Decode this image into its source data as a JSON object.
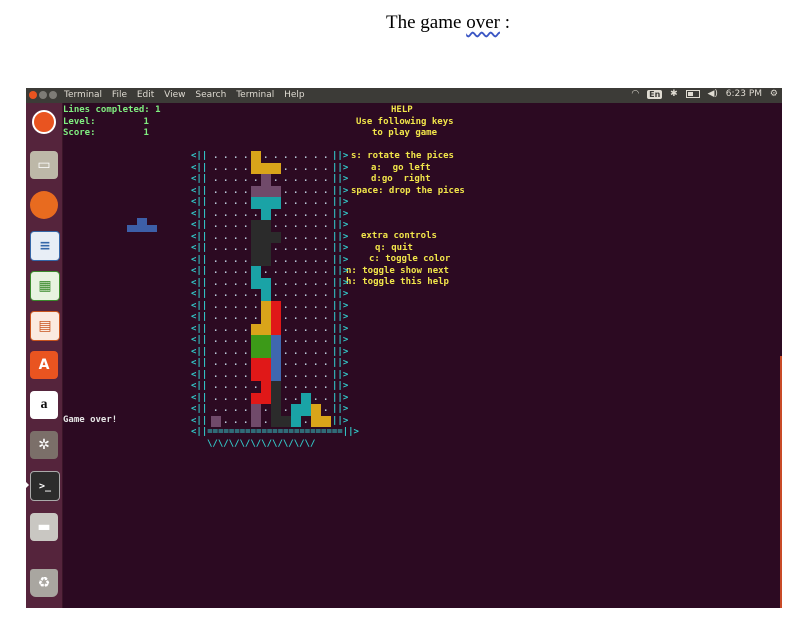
{
  "document": {
    "caption_pre": "The game ",
    "caption_word": "over",
    "caption_post": " :"
  },
  "topbar": {
    "menus": [
      "Terminal",
      "File",
      "Edit",
      "View",
      "Search",
      "Terminal",
      "Help"
    ],
    "keyboard": "En",
    "wifi_icon": "wifi-icon",
    "bluetooth_icon": "bluetooth-icon",
    "battery_level": 0.5,
    "volume_icon": "volume-icon",
    "time": "6:23 PM",
    "gear_icon": "gear-icon"
  },
  "launcher": {
    "items": [
      {
        "name": "ubuntu-logo-icon",
        "glyph": "◉"
      },
      {
        "name": "files-icon",
        "glyph": "▭"
      },
      {
        "name": "firefox-icon",
        "glyph": "●"
      },
      {
        "name": "writer-icon",
        "glyph": "≡"
      },
      {
        "name": "calc-icon",
        "glyph": "▦"
      },
      {
        "name": "impress-icon",
        "glyph": "▤"
      },
      {
        "name": "software-center-icon",
        "glyph": "A"
      },
      {
        "name": "amazon-icon",
        "glyph": "a"
      },
      {
        "name": "system-settings-icon",
        "glyph": "✲"
      },
      {
        "name": "terminal-icon",
        "glyph": ">_"
      },
      {
        "name": "drive-icon",
        "glyph": "▬"
      },
      {
        "name": "trash-icon",
        "glyph": "♻"
      }
    ]
  },
  "game": {
    "stats": {
      "lines_label": "Lines completed:",
      "lines_value": "1",
      "level_label": "Level:",
      "level_value": "1",
      "score_label": "Score:",
      "score_value": "1"
    },
    "status": "Game over!",
    "help": {
      "title": "HELP",
      "line1": "Use following keys",
      "line2": "to play game",
      "rotate": "s: rotate the pices",
      "left": "a:  go left",
      "right": "d:go  right",
      "drop": "space: drop the pices",
      "extra_title": "extra controls",
      "quit": "q: quit",
      "color": "c: toggle color",
      "next": "n: toggle show next",
      "helpkey": "h: toggle this help"
    },
    "wall_left": "<||",
    "wall_right": "||>",
    "floor": "<||=========================||>",
    "base": "\\/\\/\\/\\/\\/\\/\\/\\/\\/\\/",
    "colors": {
      "yellow": "#d9a41a",
      "purple": "#704a6a",
      "teal": "#1aa3a6",
      "dark": "#2b2b2b",
      "red": "#e01818",
      "green": "#3c9a18",
      "blue": "#3f67ae",
      "gray": "#3a3a3a"
    },
    "next_piece_color": "#3d5fa8",
    "board_cells": [
      [
        0,
        4,
        "yellow"
      ],
      [
        1,
        4,
        "yellow"
      ],
      [
        1,
        5,
        "yellow"
      ],
      [
        1,
        6,
        "yellow"
      ],
      [
        2,
        5,
        "purple"
      ],
      [
        3,
        4,
        "purple"
      ],
      [
        3,
        5,
        "purple"
      ],
      [
        3,
        6,
        "purple"
      ],
      [
        4,
        4,
        "teal"
      ],
      [
        4,
        5,
        "teal"
      ],
      [
        4,
        6,
        "teal"
      ],
      [
        5,
        5,
        "teal"
      ],
      [
        6,
        4,
        "dark"
      ],
      [
        6,
        5,
        "dark"
      ],
      [
        7,
        4,
        "dark"
      ],
      [
        7,
        5,
        "dark"
      ],
      [
        7,
        6,
        "dark"
      ],
      [
        8,
        4,
        "dark"
      ],
      [
        8,
        5,
        "dark"
      ],
      [
        9,
        4,
        "dark"
      ],
      [
        9,
        5,
        "dark"
      ],
      [
        10,
        4,
        "teal"
      ],
      [
        11,
        4,
        "teal"
      ],
      [
        11,
        5,
        "teal"
      ],
      [
        12,
        5,
        "teal"
      ],
      [
        13,
        5,
        "yellow"
      ],
      [
        13,
        6,
        "red"
      ],
      [
        14,
        5,
        "yellow"
      ],
      [
        14,
        6,
        "red"
      ],
      [
        15,
        4,
        "yellow"
      ],
      [
        15,
        5,
        "yellow"
      ],
      [
        15,
        6,
        "red"
      ],
      [
        16,
        4,
        "green"
      ],
      [
        16,
        5,
        "green"
      ],
      [
        16,
        6,
        "blue"
      ],
      [
        17,
        4,
        "green"
      ],
      [
        17,
        5,
        "green"
      ],
      [
        17,
        6,
        "blue"
      ],
      [
        18,
        4,
        "red"
      ],
      [
        18,
        5,
        "red"
      ],
      [
        18,
        6,
        "blue"
      ],
      [
        19,
        4,
        "red"
      ],
      [
        19,
        5,
        "red"
      ],
      [
        19,
        6,
        "blue"
      ],
      [
        20,
        5,
        "red"
      ],
      [
        20,
        6,
        "dark"
      ],
      [
        21,
        4,
        "red"
      ],
      [
        21,
        5,
        "red"
      ],
      [
        21,
        6,
        "dark"
      ],
      [
        21,
        9,
        "teal"
      ],
      [
        22,
        4,
        "purple"
      ],
      [
        22,
        6,
        "dark"
      ],
      [
        22,
        8,
        "teal"
      ],
      [
        22,
        9,
        "teal"
      ],
      [
        22,
        10,
        "yellow"
      ],
      [
        23,
        0,
        "purple"
      ],
      [
        23,
        4,
        "purple"
      ],
      [
        23,
        6,
        "dark"
      ],
      [
        23,
        7,
        "dark"
      ],
      [
        23,
        8,
        "teal"
      ],
      [
        23,
        10,
        "yellow"
      ],
      [
        23,
        11,
        "yellow"
      ]
    ]
  }
}
